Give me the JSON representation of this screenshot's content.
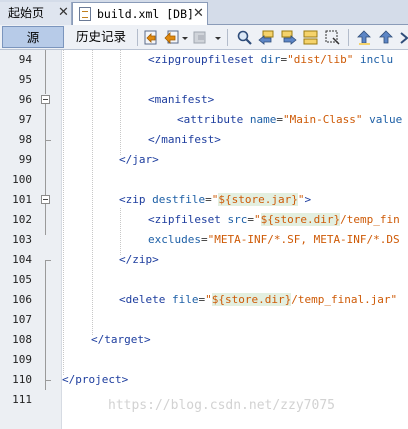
{
  "tabs": [
    {
      "label": "起始页",
      "close": "✕"
    },
    {
      "label": "build.xml [DB]",
      "close": "✕"
    }
  ],
  "toolbar": {
    "source_label": "源",
    "history_label": "历史记录"
  },
  "lines": [
    {
      "num": "94"
    },
    {
      "num": "95"
    },
    {
      "num": "96"
    },
    {
      "num": "97"
    },
    {
      "num": "98"
    },
    {
      "num": "99"
    },
    {
      "num": "100"
    },
    {
      "num": "101"
    },
    {
      "num": "102"
    },
    {
      "num": "103"
    },
    {
      "num": "104"
    },
    {
      "num": "105"
    },
    {
      "num": "106"
    },
    {
      "num": "107"
    },
    {
      "num": "108"
    },
    {
      "num": "109"
    },
    {
      "num": "110"
    },
    {
      "num": "111"
    }
  ],
  "code": {
    "l94": {
      "open": "<zipgroupfileset",
      "a1": "dir",
      "eq": "=",
      "v1": "\"dist/lib\"",
      "a2": "inclu"
    },
    "l96": {
      "open": "<manifest>"
    },
    "l97": {
      "open": "<attribute",
      "a1": "name",
      "eq": "=",
      "v1": "\"Main-Class\"",
      "a2": "value"
    },
    "l98": {
      "open": "</manifest>"
    },
    "l99": {
      "open": "</jar>"
    },
    "l101": {
      "open": "<zip",
      "a1": "destfile",
      "eq": "=",
      "q1": "\"",
      "v1": "${store.jar}",
      "q2": "\"",
      "close": ">"
    },
    "l102": {
      "open": "<zipfileset",
      "a1": "src",
      "eq": "=",
      "q1": "\"",
      "v1": "${store.dir}",
      "rest": "/temp_fin"
    },
    "l103": {
      "a1": "excludes",
      "eq": "=",
      "v1": "\"META-INF/*.SF, META-INF/*.DS"
    },
    "l104": {
      "open": "</zip>"
    },
    "l106": {
      "open": "<delete",
      "a1": "file",
      "eq": "=",
      "q1": "\"",
      "v1": "${store.dir}",
      "rest": "/temp_final.jar\""
    },
    "l108": {
      "open": "</target>"
    },
    "l110": {
      "open": "</project>"
    }
  },
  "watermark": "https://blog.csdn.net/zzy7075",
  "icons": {
    "back": "back-history-icon",
    "forward": "forward-icon",
    "search": "find-icon"
  },
  "colors": {
    "tag": "#1d3d9e",
    "attribute": "#1d5fa6",
    "value": "#ce5a06",
    "variable_bg": "#e3efe0"
  }
}
